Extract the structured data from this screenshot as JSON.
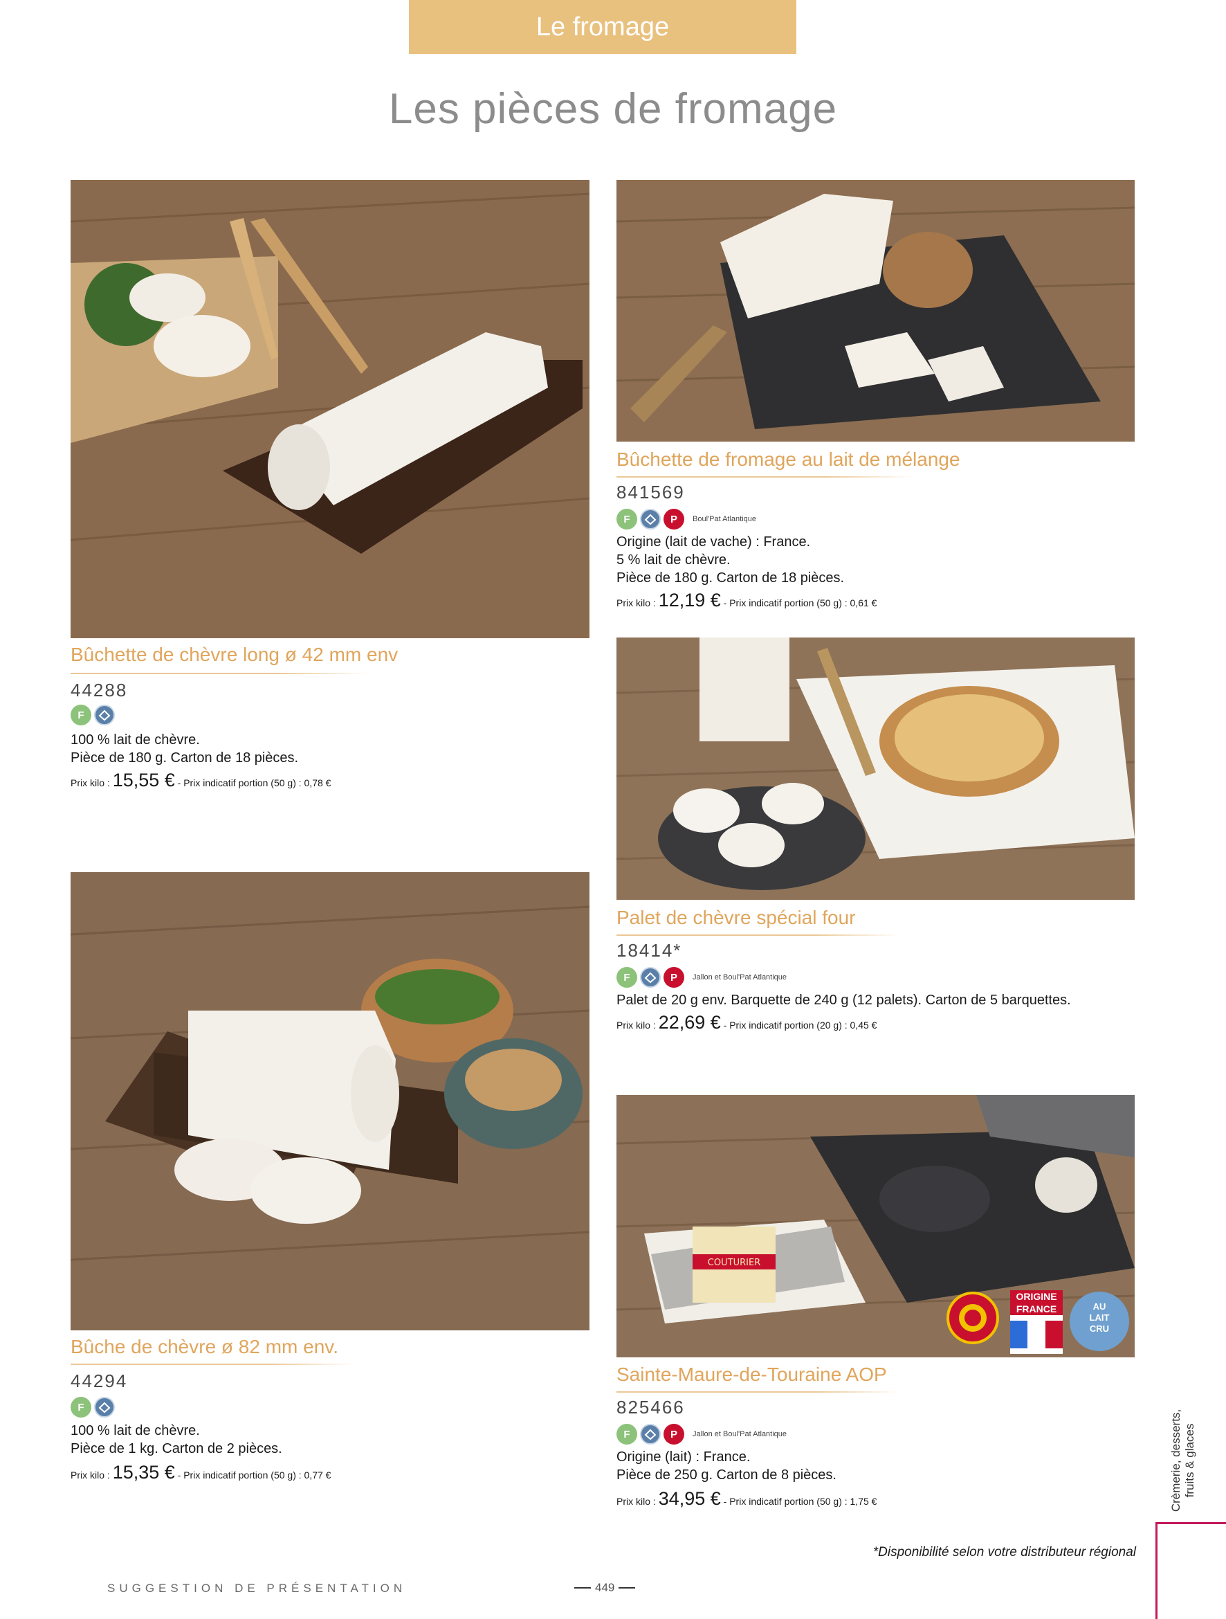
{
  "header": {
    "section_tab": "Le fromage",
    "page_title": "Les pièces de fromage"
  },
  "products": [
    {
      "title": "Bûchette de chèvre long ø 42 mm env",
      "code": "44288",
      "badges": [
        "F",
        "fresh-icon"
      ],
      "supplier": "",
      "description": [
        "100 % lait de chèvre.",
        "Pièce de 180 g. Carton de 18 pièces."
      ],
      "price_prefix": "Prix kilo :",
      "price": "15,55 €",
      "price_suffix": "- Prix indicatif portion (50 g) : 0,78 €"
    },
    {
      "title": "Bûchette de fromage au lait de mélange",
      "code": "841569",
      "badges": [
        "F",
        "fresh-icon",
        "P"
      ],
      "supplier": "Boul'Pat Atlantique",
      "description": [
        "Origine (lait de vache) : France.",
        "5 % lait de chèvre.",
        "Pièce de 180 g. Carton de 18 pièces."
      ],
      "price_prefix": "Prix kilo :",
      "price": "12,19 €",
      "price_suffix": "- Prix indicatif portion (50 g) : 0,61 €"
    },
    {
      "title": "Palet de chèvre spécial four",
      "code": "18414*",
      "badges": [
        "F",
        "fresh-icon",
        "P"
      ],
      "supplier": "Jallon et Boul'Pat Atlantique",
      "description": [
        "Palet de 20 g env. Barquette de 240 g (12 palets). Carton de 5 barquettes."
      ],
      "price_prefix": "Prix kilo :",
      "price": "22,69 €",
      "price_suffix": "- Prix indicatif portion (20 g) : 0,45 €"
    },
    {
      "title": "Bûche de chèvre ø 82 mm env.",
      "code": "44294",
      "badges": [
        "F",
        "fresh-icon"
      ],
      "supplier": "",
      "description": [
        "100 % lait de chèvre.",
        "Pièce de 1 kg. Carton de 2 pièces."
      ],
      "price_prefix": "Prix kilo :",
      "price": "15,35 €",
      "price_suffix": "- Prix indicatif portion (50 g) : 0,77 €"
    },
    {
      "title": "Sainte-Maure-de-Touraine AOP",
      "code": "825466",
      "badges": [
        "F",
        "fresh-icon",
        "P"
      ],
      "supplier": "Jallon et Boul'Pat Atlantique",
      "description": [
        "Origine (lait) : France.",
        "Pièce de 250 g. Carton de 8 pièces."
      ],
      "price_prefix": "Prix kilo :",
      "price": "34,95 €",
      "price_suffix": "- Prix indicatif portion (50 g) : 1,75 €"
    }
  ],
  "labels": {
    "origin_line1": "ORIGINE",
    "origin_line2": "FRANCE",
    "raw_milk_line1": "AU",
    "raw_milk_line2": "LAIT",
    "raw_milk_line3": "CRU",
    "cheese_band": "COUTURIER"
  },
  "sidebar": {
    "category": "Crèmerie, desserts, fruits & glaces"
  },
  "footer": {
    "note": "*Disponibilité selon votre distributeur régional",
    "presentation": "SUGGESTION DE PRÉSENTATION",
    "page_number": "449"
  },
  "colors": {
    "accent_gold": "#e0a55c",
    "tab_gold": "#e9c17f",
    "badge_green": "#8cc27a",
    "badge_red": "#c8102e",
    "sidebar_magenta": "#c2185b"
  }
}
